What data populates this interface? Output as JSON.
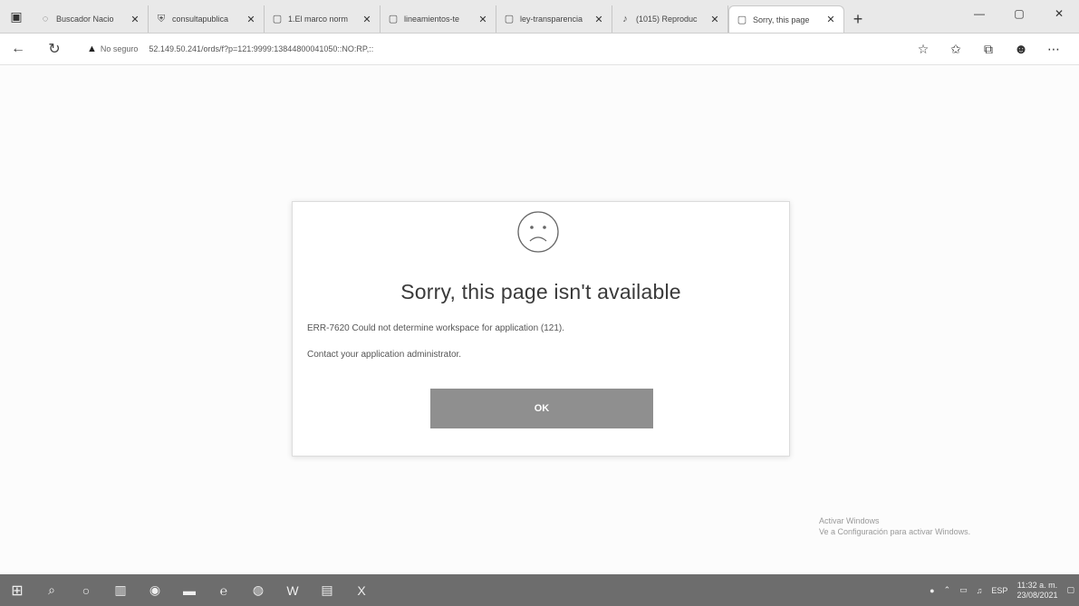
{
  "browser": {
    "tabs": [
      {
        "icon": "globe-icon",
        "glyph": "◌",
        "title": "Buscador Nacio"
      },
      {
        "icon": "shield-icon",
        "glyph": "⛨",
        "title": "consultapublica"
      },
      {
        "icon": "page-icon",
        "glyph": "▢",
        "title": "1.El marco norm"
      },
      {
        "icon": "page-icon",
        "glyph": "▢",
        "title": "lineamientos-te"
      },
      {
        "icon": "page-icon",
        "glyph": "▢",
        "title": "ley-transparencia"
      },
      {
        "icon": "bell-icon",
        "glyph": "♪",
        "title": "(1015) Reproduc"
      },
      {
        "icon": "page-icon",
        "glyph": "▢",
        "title": "Sorry, this page"
      }
    ],
    "active_tab_index": 6,
    "tab_close_glyph": "✕",
    "new_tab_glyph": "+",
    "window_controls": {
      "minimize": "—",
      "restore": "▢",
      "close": "✕"
    },
    "address": {
      "security_label": "No seguro",
      "url": "52.149.50.241/ords/f?p=121:9999:13844800041050::NO:RP,::"
    }
  },
  "dialog": {
    "title": "Sorry, this page isn't available",
    "error_message": "ERR-7620 Could not determine workspace for application (121).",
    "contact_message": "Contact your application administrator.",
    "ok_label": "OK"
  },
  "activate_windows": {
    "line1": "Activar Windows",
    "line2": "Ve a Configuración para activar Windows."
  },
  "taskbar": {
    "tray_language": "ESP",
    "time": "11:32 a. m.",
    "date": "23/08/2021"
  },
  "colors": {
    "tabstrip": "#e9e9e9",
    "ok_button": "#8f8f8f",
    "taskbar": "#6d6d6d"
  }
}
